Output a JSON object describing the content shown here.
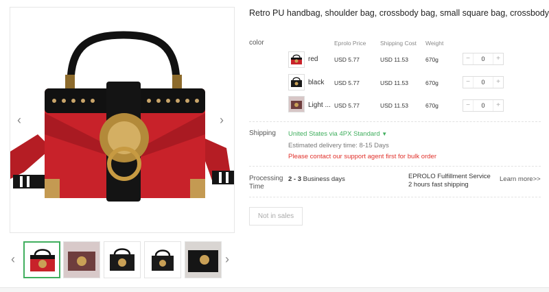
{
  "product": {
    "title": "Retro PU handbag, shoulder bag, crossbody bag, small square bag, crossbody bag"
  },
  "gallery": {
    "prev_icon": "‹",
    "next_icon": "›",
    "thumb_prev_icon": "‹",
    "thumb_next_icon": "›",
    "active_thumb": 0,
    "thumb_count": 5
  },
  "variants": {
    "label": "color",
    "headers": {
      "price": "Eprolo Price",
      "shipping": "Shipping Cost",
      "weight": "Weight"
    },
    "rows": [
      {
        "name": "red",
        "price": "USD 5.77",
        "shipping": "USD 11.53",
        "weight": "670g",
        "qty": "0",
        "minus": "−",
        "plus": "+"
      },
      {
        "name": "black",
        "price": "USD 5.77",
        "shipping": "USD 11.53",
        "weight": "670g",
        "qty": "0",
        "minus": "−",
        "plus": "+"
      },
      {
        "name": "Light ...",
        "price": "USD 5.77",
        "shipping": "USD 11.53",
        "weight": "670g",
        "qty": "0",
        "minus": "−",
        "plus": "+"
      }
    ]
  },
  "shipping": {
    "label": "Shipping",
    "method": "United States via 4PX Standard",
    "dropdown_icon": "▼",
    "estimate": "Estimated delivery time: 8-15 Days",
    "bulk_notice": "Please contact our support agent first for bulk order"
  },
  "processing": {
    "label_line1": "Processing",
    "label_line2": "Time",
    "days_bold": "2 - 3",
    "days_text": "Business days",
    "service_line1": "EPROLO Fulfillment Service",
    "service_line2": "2 hours fast shipping",
    "learn_more": "Learn more>>"
  },
  "action": {
    "button_label": "Not in sales"
  },
  "colors": {
    "accent_green": "#3fae5d",
    "notice_red": "#e0302a",
    "bag_red": "#c8222a"
  }
}
